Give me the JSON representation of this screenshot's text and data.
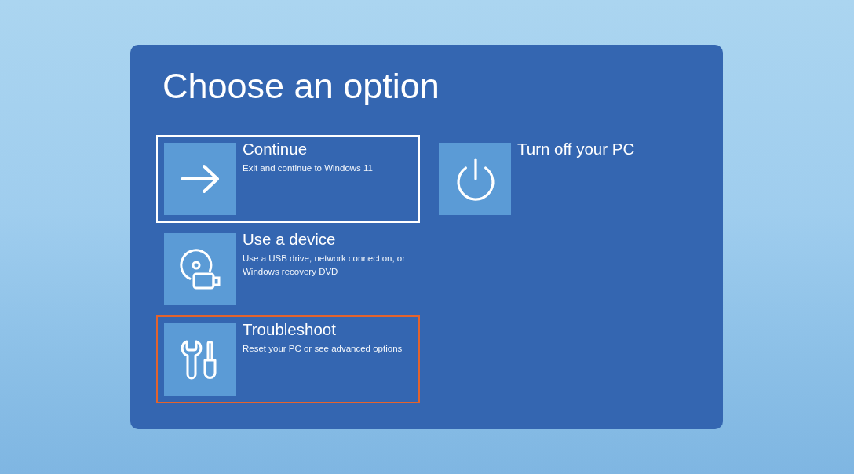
{
  "screen": {
    "title": "Choose an option"
  },
  "columns": [
    {
      "options": [
        {
          "kind": "arrow",
          "title": "Continue",
          "description": "Exit and continue to Windows 11",
          "selected": true,
          "highlighted": false
        },
        {
          "kind": "device",
          "title": "Use a device",
          "description": "Use a USB drive, network connection, or Windows recovery DVD",
          "selected": false,
          "highlighted": false
        },
        {
          "kind": "tools",
          "title": "Troubleshoot",
          "description": "Reset your PC or see advanced options",
          "selected": false,
          "highlighted": true
        }
      ]
    },
    {
      "options": [
        {
          "kind": "power",
          "title": "Turn off your PC",
          "selected": false,
          "highlighted": false
        }
      ]
    }
  ]
}
